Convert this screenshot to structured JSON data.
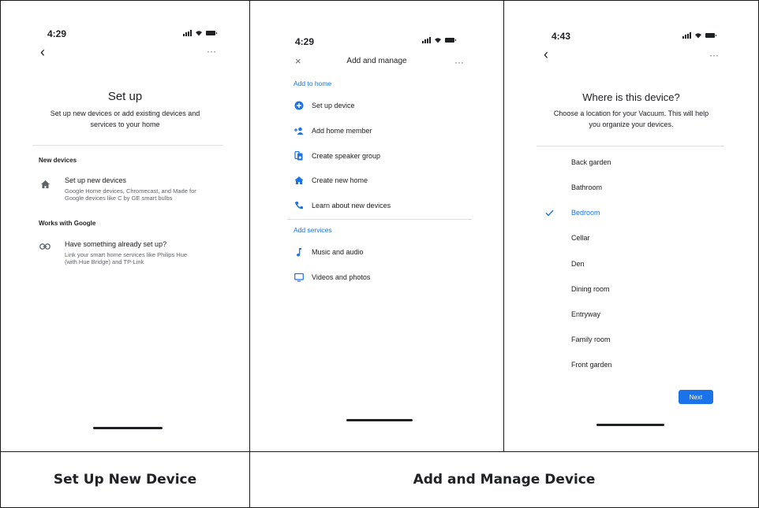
{
  "captions": {
    "left": "Set Up New Device",
    "right": "Add and Manage Device"
  },
  "panel1": {
    "time": "4:29",
    "title": "Set up",
    "subtitle_line1": "Set up new devices or add existing devices and",
    "subtitle_line2": "services to your home",
    "new_devices_heading": "New devices",
    "setup_item_title": "Set up new devices",
    "setup_item_desc_line1": "Google Home devices, Chromecast, and Made for",
    "setup_item_desc_line2": "Google devices like C by GE smart bulbs",
    "works_heading": "Works with Google",
    "works_item_title": "Have something already set up?",
    "works_item_desc_line1": "Link your smart home services like Philips Hue",
    "works_item_desc_line2": "(with Hue Bridge) and TP-Link",
    "icons": [
      "back-arrow-icon",
      "more-icon",
      "home-icon",
      "link-icon"
    ]
  },
  "panel2": {
    "time": "4:29",
    "title": "Add and manage",
    "add_to_home_label": "Add to home",
    "add_items": [
      {
        "label": "Set up device",
        "icon": "plus-circle-icon"
      },
      {
        "label": "Add home member",
        "icon": "add-person-icon"
      },
      {
        "label": "Create speaker group",
        "icon": "speaker-group-icon"
      },
      {
        "label": "Create new home",
        "icon": "home-icon"
      },
      {
        "label": "Learn about new devices",
        "icon": "phone-icon"
      }
    ],
    "add_services_label": "Add services",
    "service_items": [
      {
        "label": "Music and audio",
        "icon": "music-note-icon"
      },
      {
        "label": "Videos and photos",
        "icon": "tv-icon"
      }
    ],
    "accent_color": "#1a73e8"
  },
  "panel3": {
    "time": "4:43",
    "title": "Where is this device?",
    "subtitle_line1": "Choose a location for your Vacuum. This will help",
    "subtitle_line2": "you organize your devices.",
    "rooms": [
      "Back garden",
      "Bathroom",
      "Bedroom",
      "Cellar",
      "Den",
      "Dining room",
      "Entryway",
      "Family room",
      "Front garden"
    ],
    "selected_room": "Bedroom",
    "next_label": "Next",
    "accent_color": "#1a73e8"
  }
}
